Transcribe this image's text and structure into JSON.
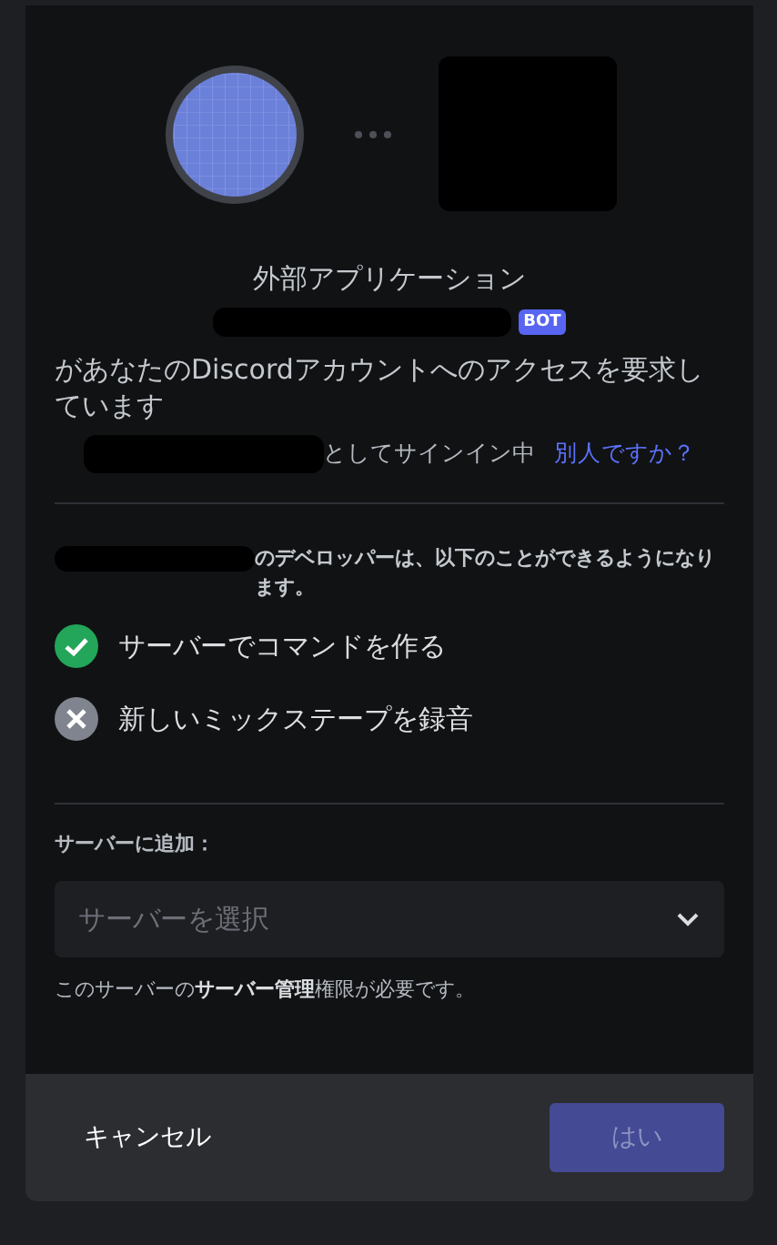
{
  "header": {
    "subtitle": "外部アプリケーション",
    "badge": "BOT",
    "request": "があなたのDiscordアカウントへのアクセスを要求しています",
    "signed_in": "としてサインイン中",
    "switch_link": "別人ですか？"
  },
  "permissions": {
    "intro": "のデベロッパーは、以下のことができるようになります。",
    "items": [
      {
        "label": "サーバーでコマンドを作る",
        "granted": true
      },
      {
        "label": "新しいミックステープを録音",
        "granted": false
      }
    ]
  },
  "server": {
    "label": "サーバーに追加：",
    "placeholder": "サーバーを選択",
    "note": "このサーバーの**サーバー管理**権限が必要です。"
  },
  "footer": {
    "cancel": "キャンセル",
    "confirm": "はい",
    "confirm_disabled": true
  }
}
